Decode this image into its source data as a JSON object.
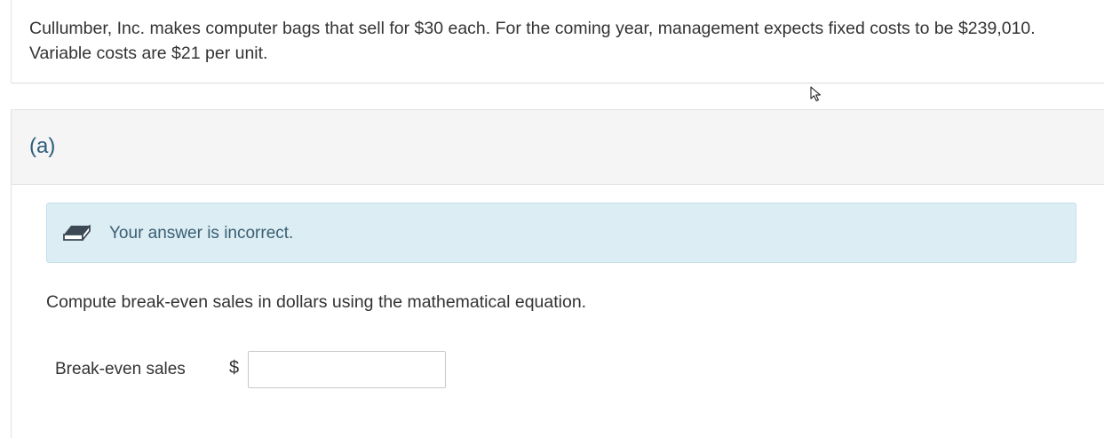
{
  "problem": {
    "line1": "Cullumber, Inc. makes computer bags that sell for $30 each. For the coming year, management expects fixed costs to be $239,010.",
    "line2": "Variable costs are $21 per unit."
  },
  "part": {
    "label": "(a)",
    "feedback": {
      "icon": "eraser-icon",
      "text": "Your answer is incorrect.",
      "background_color": "#dcedf4"
    },
    "instruction": "Compute break-even sales in dollars using the mathematical equation.",
    "answer": {
      "label": "Break-even sales",
      "currency_symbol": "$",
      "value": "",
      "placeholder": ""
    }
  },
  "colors": {
    "part_label": "#2c5d7a",
    "feedback_text": "#3a5f73",
    "header_background": "#f5f5f5"
  }
}
